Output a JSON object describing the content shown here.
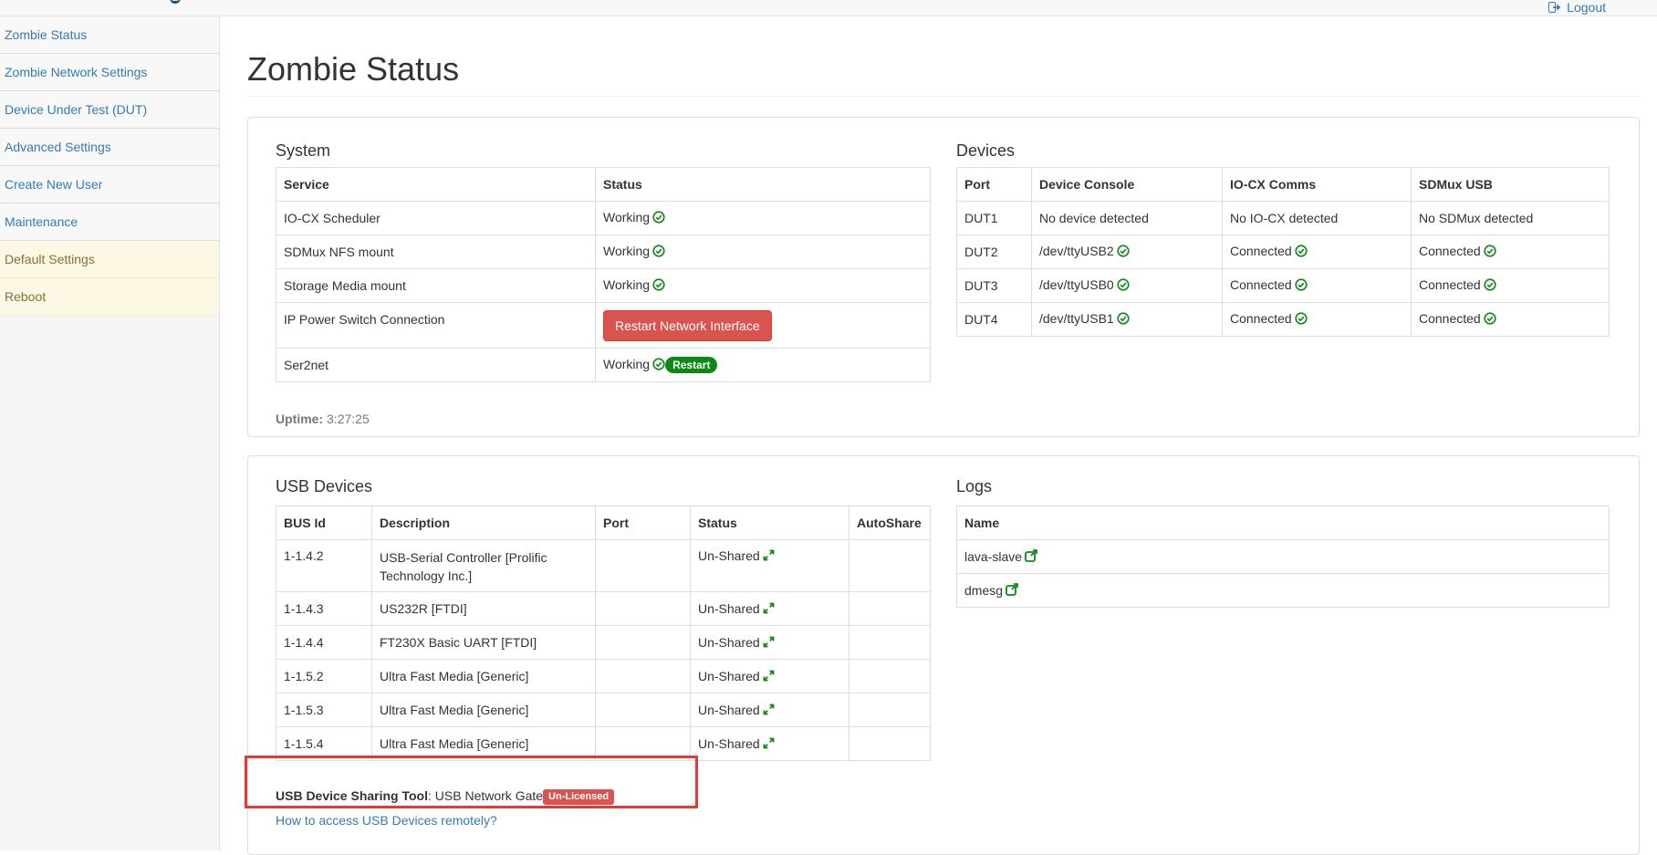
{
  "header": {
    "logout_label": "Logout"
  },
  "sidebar": {
    "items": [
      {
        "label": "Zombie Status"
      },
      {
        "label": "Zombie Network Settings"
      },
      {
        "label": "Device Under Test (DUT)"
      },
      {
        "label": "Advanced Settings"
      },
      {
        "label": "Create New User"
      },
      {
        "label": "Maintenance"
      },
      {
        "label": "Default Settings"
      },
      {
        "label": "Reboot"
      }
    ]
  },
  "page": {
    "title": "Zombie Status"
  },
  "system": {
    "heading": "System",
    "columns": [
      "Service",
      "Status"
    ],
    "rows": [
      {
        "service": "IO-CX Scheduler",
        "status": "Working"
      },
      {
        "service": "SDMux NFS mount",
        "status": "Working"
      },
      {
        "service": "Storage Media mount",
        "status": "Working"
      },
      {
        "service": "IP Power Switch Connection",
        "button": "Restart Network Interface"
      },
      {
        "service": "Ser2net",
        "status": "Working",
        "pill": "Restart"
      }
    ],
    "uptime_label": "Uptime:",
    "uptime_value": "3:27:25"
  },
  "devices": {
    "heading": "Devices",
    "columns": [
      "Port",
      "Device Console",
      "IO-CX Comms",
      "SDMux USB"
    ],
    "rows": [
      {
        "port": "DUT1",
        "console": "No device detected",
        "iocx": "No IO-CX detected",
        "sdmux": "No SDMux detected"
      },
      {
        "port": "DUT2",
        "console": "/dev/ttyUSB2",
        "iocx": "Connected",
        "sdmux": "Connected"
      },
      {
        "port": "DUT3",
        "console": "/dev/ttyUSB0",
        "iocx": "Connected",
        "sdmux": "Connected"
      },
      {
        "port": "DUT4",
        "console": "/dev/ttyUSB1",
        "iocx": "Connected",
        "sdmux": "Connected"
      }
    ]
  },
  "usb": {
    "heading": "USB Devices",
    "columns": [
      "BUS Id",
      "Description",
      "Port",
      "Status",
      "AutoShare"
    ],
    "rows": [
      {
        "bus": "1-1.4.2",
        "desc": "USB-Serial Controller [Prolific Technology Inc.]",
        "port": "",
        "status": "Un-Shared",
        "autoshare": ""
      },
      {
        "bus": "1-1.4.3",
        "desc": "US232R [FTDI]",
        "port": "",
        "status": "Un-Shared",
        "autoshare": ""
      },
      {
        "bus": "1-1.4.4",
        "desc": "FT230X Basic UART [FTDI]",
        "port": "",
        "status": "Un-Shared",
        "autoshare": ""
      },
      {
        "bus": "1-1.5.2",
        "desc": "Ultra Fast Media [Generic]",
        "port": "",
        "status": "Un-Shared",
        "autoshare": ""
      },
      {
        "bus": "1-1.5.3",
        "desc": "Ultra Fast Media [Generic]",
        "port": "",
        "status": "Un-Shared",
        "autoshare": ""
      },
      {
        "bus": "1-1.5.4",
        "desc": "Ultra Fast Media [Generic]",
        "port": "",
        "status": "Un-Shared",
        "autoshare": ""
      }
    ],
    "tool_label": "USB Device Sharing Tool",
    "tool_value": ": USB Network Gate",
    "tool_badge": "Un-Licensed",
    "howto_link": "How to access USB Devices remotely?"
  },
  "logs": {
    "heading": "Logs",
    "columns": [
      "Name"
    ],
    "rows": [
      {
        "name": "lava-slave"
      },
      {
        "name": "dmesg"
      }
    ]
  },
  "colors": {
    "link": "#337ab7",
    "danger": "#d9534f",
    "success": "#0a8a12",
    "warning_bg": "#fcf8e3",
    "highlight": "#e53935"
  }
}
